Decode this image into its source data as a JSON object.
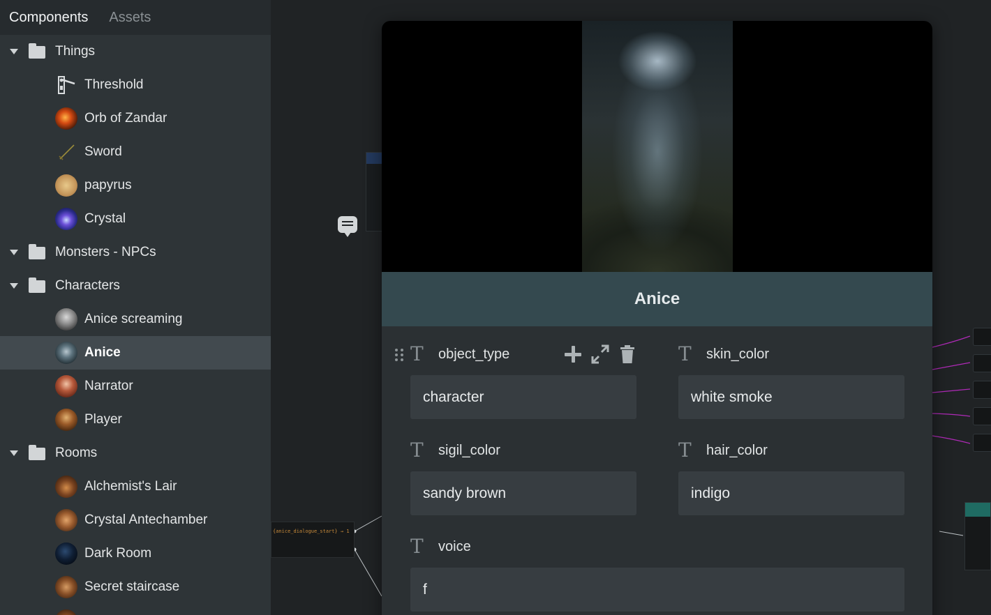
{
  "sidebar": {
    "tabs": [
      {
        "label": "Components",
        "active": true
      },
      {
        "label": "Assets",
        "active": false
      }
    ],
    "folders": [
      {
        "label": "Things",
        "items": [
          {
            "label": "Threshold",
            "icon": "threshold-icon"
          },
          {
            "label": "Orb of Zandar",
            "icon": "orb-thumbnail"
          },
          {
            "label": "Sword",
            "icon": "sword-icon"
          },
          {
            "label": "papyrus",
            "icon": "papyrus-thumbnail"
          },
          {
            "label": "Crystal",
            "icon": "crystal-thumbnail"
          }
        ]
      },
      {
        "label": "Monsters - NPCs",
        "items": []
      },
      {
        "label": "Characters",
        "items": [
          {
            "label": "Anice screaming",
            "icon": "anice-screaming-thumbnail"
          },
          {
            "label": "Anice",
            "icon": "anice-thumbnail",
            "selected": true
          },
          {
            "label": "Narrator",
            "icon": "narrator-thumbnail"
          },
          {
            "label": "Player",
            "icon": "player-thumbnail"
          }
        ]
      },
      {
        "label": "Rooms",
        "items": [
          {
            "label": "Alchemist's Lair",
            "icon": "alchemists-lair-thumbnail"
          },
          {
            "label": "Crystal Antechamber",
            "icon": "crystal-antechamber-thumbnail"
          },
          {
            "label": "Dark Room",
            "icon": "dark-room-thumbnail"
          },
          {
            "label": "Secret staircase",
            "icon": "secret-staircase-thumbnail"
          }
        ]
      }
    ]
  },
  "canvas": {
    "code_snippet": "{anice_dialogue_start} → 1"
  },
  "detail": {
    "title": "Anice",
    "fields": [
      {
        "name": "object_type",
        "value": "character"
      },
      {
        "name": "skin_color",
        "value": "white smoke"
      },
      {
        "name": "sigil_color",
        "value": "sandy brown"
      },
      {
        "name": "hair_color",
        "value": "indigo"
      },
      {
        "name": "voice",
        "value": "f"
      }
    ]
  },
  "colors": {
    "sidebar_bg": "#2e3437",
    "selected_row": "#424a4f",
    "title_band": "#34494f",
    "field_bg": "#373d41",
    "connector_purple": "#b02ab8"
  }
}
